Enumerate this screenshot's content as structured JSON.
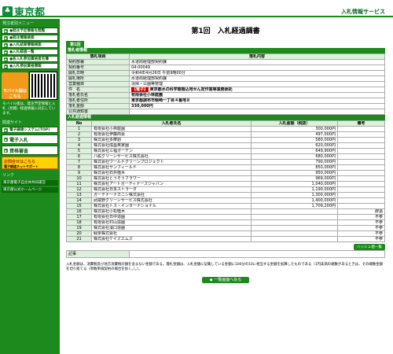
{
  "header": {
    "logo_mark": "♣",
    "logo_text": "東京都",
    "site_title": "入札情報サービス"
  },
  "sidebar": {
    "heading": "発注者別メニュー",
    "items": [
      "●発注予定情報を閲覧",
      "●発注情報検索",
      "●入札結果情報検索",
      "●入札経過一覧",
      "●各入札参加資格者名簿",
      "●入札参加資格情報"
    ],
    "mobile_label": "モバイル版はこちら",
    "mobile_note": "モバイル版は、発注予定情報と入札（見積）経過情報に対応しています。",
    "second_heading": "関連サイト",
    "ejoin_label": "電子調達システム(TOP)",
    "ebid_label": "電子入札",
    "qual_label": "資格審査",
    "help_label": "お問合せはこちら",
    "help_sub": "電子調達ネットサポート",
    "links_heading": "リンク",
    "links": [
      "東京都電子自治体共同運営",
      "東京都公式ホームページ"
    ]
  },
  "main": {
    "title": "第1回　入札経過調書",
    "round_tab": "第1回",
    "info_section": "落札者情報",
    "info_headers": [
      "落札項目",
      "落札内容"
    ],
    "info_rows": [
      {
        "label": "契約部署",
        "value": "水道局経理部契約課"
      },
      {
        "label": "契約番号",
        "value": "04-00049"
      },
      {
        "label": "開札日時",
        "value": "令和4年4月26日 午前9時00分"
      },
      {
        "label": "開札場所",
        "value": "水道局経理部契約課"
      },
      {
        "label": "営業種目",
        "value": "清掃・公園等管理"
      },
      {
        "label": "件　名",
        "tag": "【電子】",
        "value": "東京都水の科学館植込地せん定作業等業務委託"
      },
      {
        "label": "落札者氏名",
        "value": "有限会社小林庭園"
      },
      {
        "label": "落札者住所",
        "value": "東京都調布市柴崎一丁目４番地８"
      },
      {
        "label": "落札金額",
        "value": "330,000円"
      },
      {
        "label": "公共通知書",
        "value": ""
      }
    ],
    "bid_section": "入札経過情報",
    "bid_headers": [
      "No",
      "入札者氏名",
      "入札金額（税抜）",
      "備考"
    ],
    "bids": [
      {
        "no": "1",
        "name": "有限会社小林庭園",
        "amount": "300,000円",
        "note": ""
      },
      {
        "no": "2",
        "name": "有限会社伊藤商会",
        "amount": "497,000円",
        "note": ""
      },
      {
        "no": "3",
        "name": "株式会社多摩創",
        "amount": "580,000円",
        "note": ""
      },
      {
        "no": "4",
        "name": "株式会社成昌英家園",
        "amount": "620,000円",
        "note": ""
      },
      {
        "no": "5",
        "name": "株式会社三福ガーデン",
        "amount": "649,900円",
        "note": ""
      },
      {
        "no": "6",
        "name": "八紘グリーンサービス株式会社",
        "amount": "680,000円",
        "note": ""
      },
      {
        "no": "7",
        "name": "株式会社ワールドグリーンプロジェクト",
        "amount": "790,000円",
        "note": ""
      },
      {
        "no": "8",
        "name": "株式会社サンフィールド",
        "amount": "850,000円",
        "note": ""
      },
      {
        "no": "9",
        "name": "株式会社石井植木",
        "amount": "950,000円",
        "note": ""
      },
      {
        "no": "10",
        "name": "株式会社とうそうフラワー",
        "amount": "969,000円",
        "note": ""
      },
      {
        "no": "11",
        "name": "株式会社アートガーディナーズジャパン",
        "amount": "1,040,000円",
        "note": ""
      },
      {
        "no": "12",
        "name": "株式会社日本ストラーダ",
        "amount": "1,190,000円",
        "note": ""
      },
      {
        "no": "13",
        "name": "ガーデナーナカニシ株式会社",
        "amount": "1,300,000円",
        "note": ""
      },
      {
        "no": "14",
        "name": "武蔵野グリーンサービス株式会社",
        "amount": "1,400,000円",
        "note": ""
      },
      {
        "no": "15",
        "name": "株式会社トス・インターナショナル",
        "amount": "1,709,200円",
        "note": ""
      },
      {
        "no": "16",
        "name": "株式会社小松植木",
        "amount": "",
        "note": "辞退"
      },
      {
        "no": "17",
        "name": "有限会社日中造園",
        "amount": "",
        "note": "不参"
      },
      {
        "no": "18",
        "name": "有限会社村山造園",
        "amount": "",
        "note": "不参"
      },
      {
        "no": "19",
        "name": "株式会社濱口造園",
        "amount": "",
        "note": "不参"
      },
      {
        "no": "20",
        "name": "緑京株式会社",
        "amount": "",
        "note": "不参"
      },
      {
        "no": "21",
        "name": "株式会社ケイズエムズ",
        "amount": "",
        "note": "不参"
      }
    ],
    "history_btn": "ハッシュ値一覧",
    "remark_label": "記事",
    "notes": "入札金額は、消費税及び地方消費税の額を含まない金額である。落札金額は、入札金額に記載している金額に100分の10に相当する金額を加算したものである（1円未満の端数があるときは、その端数金額を切り捨てる（単数単価契約の場合を除く。）。）。",
    "back_btn": "一覧画面へ戻る"
  }
}
